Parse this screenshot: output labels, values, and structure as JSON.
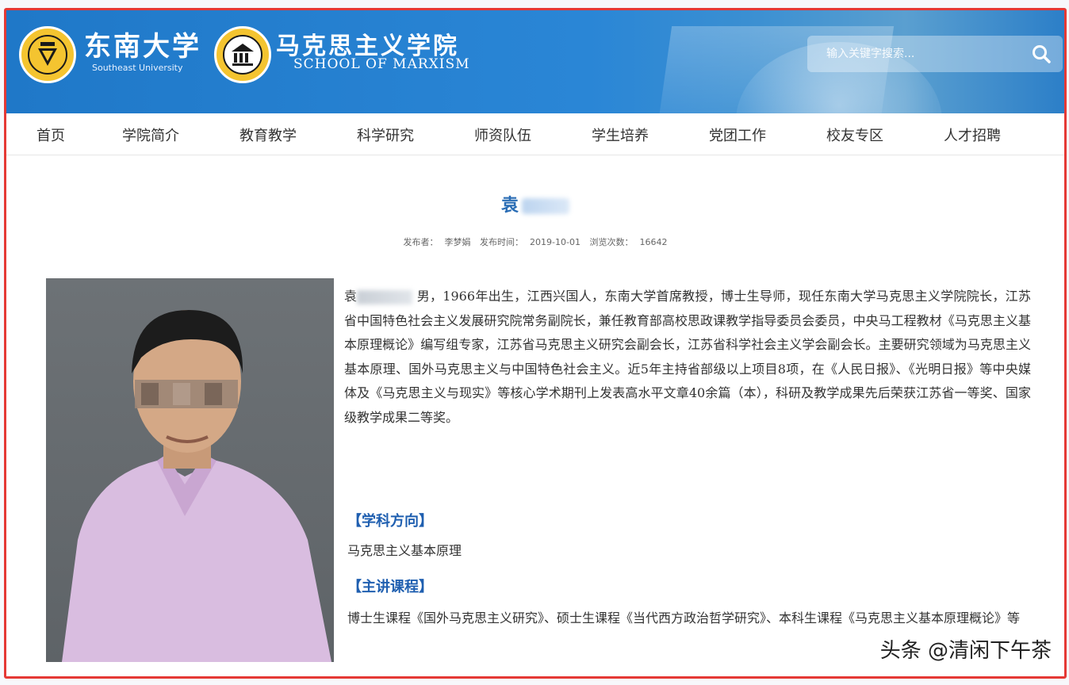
{
  "header": {
    "university_name": "东南大学",
    "university_en": "Southeast University",
    "school_name": "马克思主义学院",
    "school_en": "SCHOOL OF MARXISM",
    "search_placeholder": "输入关键字搜索...",
    "colors": {
      "primary": "#2a86d6",
      "frame": "#e53935",
      "title": "#2a6db5"
    }
  },
  "nav": {
    "items": [
      "首页",
      "学院简介",
      "教育教学",
      "科学研究",
      "师资队伍",
      "学生培养",
      "党团工作",
      "校友专区",
      "人才招聘"
    ]
  },
  "article": {
    "title_char": "袁",
    "meta": {
      "author_label": "发布者：",
      "author": "李梦娟",
      "date_label": "发布时间：",
      "date": "2019-10-01",
      "views_label": "浏览次数：",
      "views": "16642"
    },
    "bio_name_char": "袁",
    "bio": "男，1966年出生，江西兴国人，东南大学首席教授，博士生导师，现任东南大学马克思主义学院院长，江苏省中国特色社会主义发展研究院常务副院长，兼任教育部高校思政课教学指导委员会委员，中央马工程教材《马克思主义基本原理概论》编写组专家，江苏省马克思主义研究会副会长，江苏省科学社会主义学会副会长。主要研究领域为马克思主义基本原理、国外马克思主义与中国特色社会主义。近5年主持省部级以上项目8项，在《人民日报》、《光明日报》等中央媒体及《马克思主义与现实》等核心学术期刊上发表高水平文章40余篇（本），科研及教学成果先后荣获江苏省一等奖、国家级教学成果二等奖。",
    "sections": [
      {
        "heading": "【学科方向】",
        "body": "马克思主义基本原理"
      },
      {
        "heading": "【主讲课程】",
        "body": "博士生课程《国外马克思主义研究》、硕士生课程《当代西方政治哲学研究》、本科生课程《马克思主义基本原理概论》等"
      }
    ]
  },
  "watermark": "头条 @清闲下午茶"
}
